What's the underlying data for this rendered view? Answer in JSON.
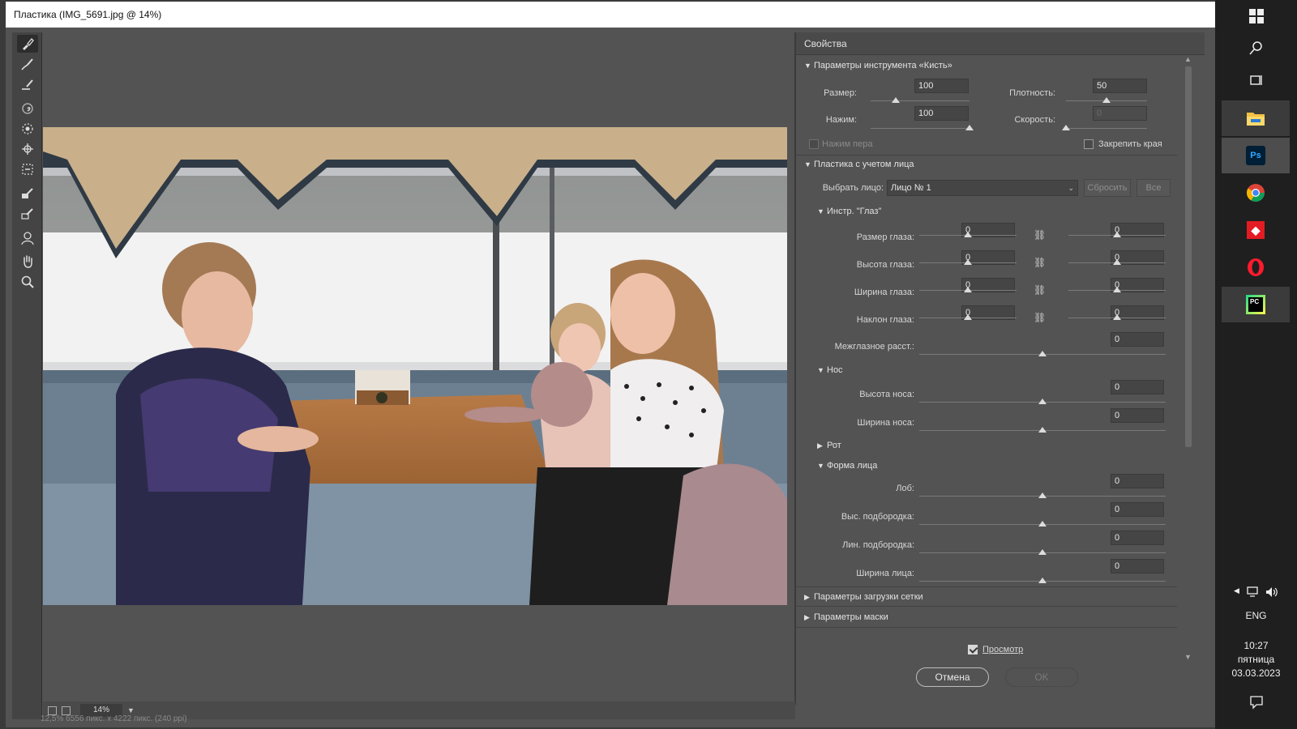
{
  "window": {
    "title": "Пластика (IMG_5691.jpg @ 14%)"
  },
  "tools": [
    {
      "name": "forward-warp-tool",
      "active": true
    },
    {
      "name": "reconstruct-tool"
    },
    {
      "name": "smooth-tool"
    },
    {
      "name": "twirl-tool"
    },
    {
      "name": "pucker-tool"
    },
    {
      "name": "bloat-tool"
    },
    {
      "name": "push-left-tool"
    },
    {
      "name": "freeze-mask-tool"
    },
    {
      "name": "thaw-mask-tool"
    },
    {
      "name": "face-tool"
    },
    {
      "name": "hand-tool"
    },
    {
      "name": "zoom-tool"
    }
  ],
  "canvas": {
    "zoom": "14%",
    "bottom_info": "12,5%     6556 пикс. x 4222 пикс. (240 ppi)"
  },
  "properties": {
    "title": "Свойства",
    "brush": {
      "header": "Параметры инструмента «Кисть»",
      "size_label": "Размер:",
      "size": "100",
      "size_level": 0.25,
      "density_label": "Плотность:",
      "density": "50",
      "density_level": 0.5,
      "pressure_label": "Нажим:",
      "pressure": "100",
      "pressure_level": 1.0,
      "rate_label": "Скорость:",
      "rate": "0",
      "rate_level": 0.0,
      "stylus_label": "Нажим пера",
      "stylus_checked": false,
      "pin_label": "Закрепить края",
      "pin_checked": false
    },
    "face": {
      "header": "Пластика с учетом лица",
      "select_label": "Выбрать лицо:",
      "select_value": "Лицо № 1",
      "reset_label": "Сбросить",
      "all_label": "Все",
      "eyes": {
        "header": "Инстр. \"Глаз\"",
        "rows": [
          {
            "label": "Размер глаза:",
            "left": "0",
            "right": "0"
          },
          {
            "label": "Высота глаза:",
            "left": "0",
            "right": "0"
          },
          {
            "label": "Ширина глаза:",
            "left": "0",
            "right": "0"
          },
          {
            "label": "Наклон глаза:",
            "left": "0",
            "right": "0"
          }
        ],
        "distance_label": "Межглазное расст.:",
        "distance": "0"
      },
      "nose": {
        "header": "Нос",
        "height_label": "Высота носа:",
        "height": "0",
        "width_label": "Ширина носа:",
        "width": "0"
      },
      "mouth": {
        "header": "Рот"
      },
      "shape": {
        "header": "Форма лица",
        "rows": [
          {
            "label": "Лоб:",
            "value": "0"
          },
          {
            "label": "Выс. подбородка:",
            "value": "0"
          },
          {
            "label": "Лин. подбородка:",
            "value": "0"
          },
          {
            "label": "Ширина лица:",
            "value": "0"
          }
        ]
      }
    },
    "mesh_header": "Параметры загрузки сетки",
    "mask_header": "Параметры маски",
    "preview_label": "Просмотр",
    "preview_checked": true,
    "cancel_label": "Отмена",
    "ok_label": "OK"
  },
  "taskbar": {
    "lang": "ENG",
    "time": "10:27",
    "day": "пятница",
    "date": "03.03.2023"
  },
  "colors": {
    "panel": "#535353",
    "accent_ps": "#31a8ff",
    "chrome_red": "#db4437",
    "opera_red": "#ff1b2d",
    "pycharm_green": "#21d789"
  }
}
